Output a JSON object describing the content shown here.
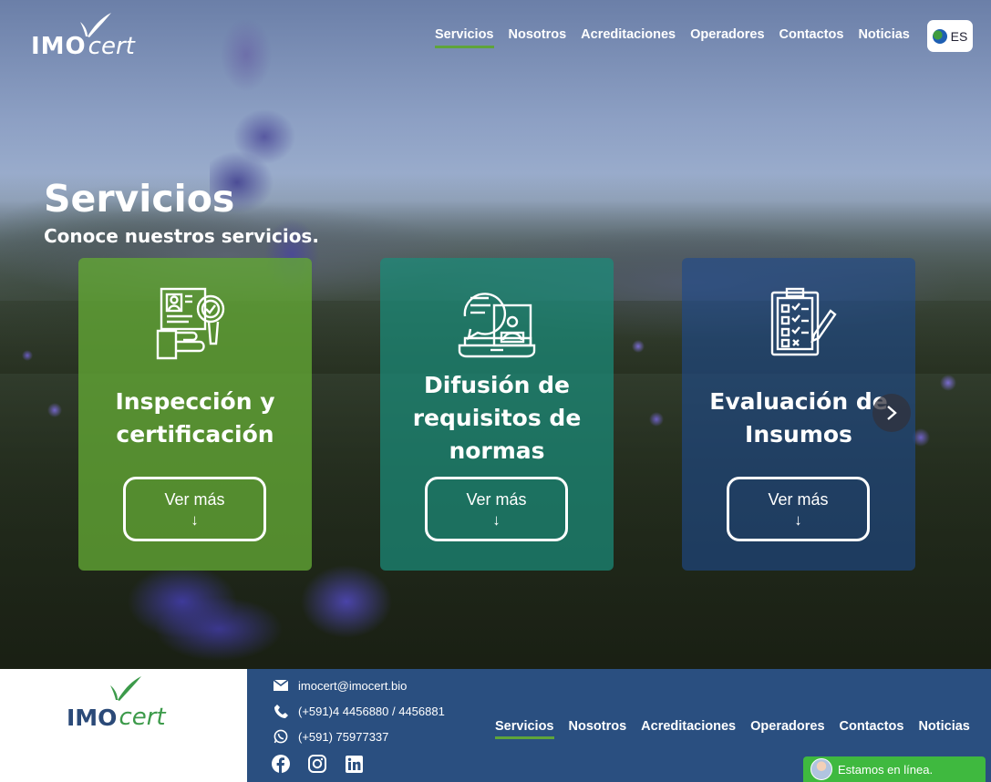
{
  "header": {
    "logo": {
      "imo": "IMO",
      "cert": "cert"
    },
    "nav": [
      {
        "label": "Servicios",
        "active": true
      },
      {
        "label": "Nosotros",
        "active": false
      },
      {
        "label": "Acreditaciones",
        "active": false
      },
      {
        "label": "Operadores",
        "active": false
      },
      {
        "label": "Contactos",
        "active": false
      },
      {
        "label": "Noticias",
        "active": false
      }
    ],
    "language": {
      "label": "ES",
      "icon": "globe-icon"
    }
  },
  "hero": {
    "title": "Servicios",
    "subtitle": "Conoce nuestros servicios."
  },
  "cards": [
    {
      "title_line1": "Inspección y",
      "title_line2": "certificación",
      "title_line3": "",
      "button": "Ver más",
      "arrow": "↓",
      "icon": "inspection-certificate-icon",
      "color": "#63a834"
    },
    {
      "title_line1": "Difusión de",
      "title_line2": "requisitos de",
      "title_line3": "normas",
      "button": "Ver más",
      "arrow": "↓",
      "icon": "laptop-documents-icon",
      "color": "#1b8c7a"
    },
    {
      "title_line1": "Evaluación de",
      "title_line2": "Insumos",
      "title_line3": "",
      "button": "Ver más",
      "arrow": "↓",
      "icon": "checklist-clipboard-icon",
      "color": "#1e4a8c"
    }
  ],
  "carousel": {
    "next_icon": "chevron-right-icon"
  },
  "footer": {
    "logo": {
      "imo": "IMO",
      "cert": "cert"
    },
    "email": "imocert@imocert.bio",
    "phone": "(+591)4 4456880 / 4456881",
    "whatsapp": "(+591) 75977337",
    "social": [
      "facebook-icon",
      "instagram-icon",
      "linkedin-icon"
    ],
    "nav": [
      {
        "label": "Servicios",
        "active": true
      },
      {
        "label": "Nosotros",
        "active": false
      },
      {
        "label": "Acreditaciones",
        "active": false
      },
      {
        "label": "Operadores",
        "active": false
      },
      {
        "label": "Contactos",
        "active": false
      },
      {
        "label": "Noticias",
        "active": false
      }
    ],
    "background": "#2a4f80",
    "accent": "#5fa43a"
  },
  "chat": {
    "label": "Estamos en línea."
  }
}
